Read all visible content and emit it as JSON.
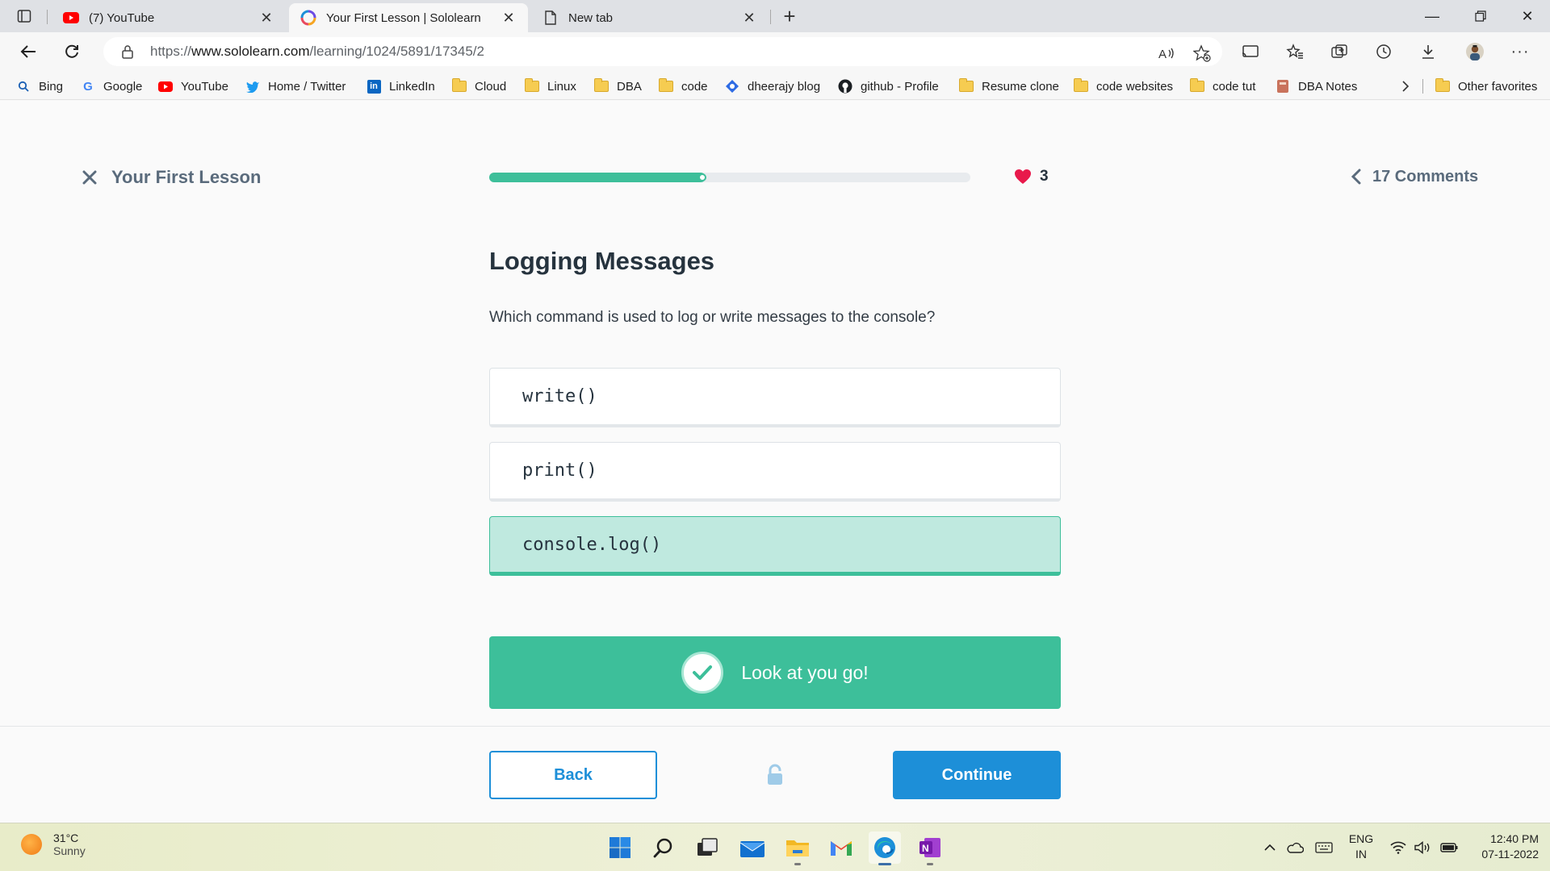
{
  "browser": {
    "tabs": [
      {
        "title": "(7) YouTube",
        "favicon": "youtube-icon",
        "active": false
      },
      {
        "title": "Your First Lesson | Sololearn",
        "favicon": "sololearn-icon",
        "active": true
      },
      {
        "title": "New tab",
        "favicon": "page-icon",
        "active": false
      }
    ],
    "url_prefix": "https://",
    "url_host": "www.sololearn.com",
    "url_path": "/learning/1024/5891/17345/2",
    "favorites": [
      {
        "label": "Bing",
        "icon": "search-icon"
      },
      {
        "label": "Google",
        "icon": "google-icon"
      },
      {
        "label": "YouTube",
        "icon": "youtube-icon"
      },
      {
        "label": "Home / Twitter",
        "icon": "twitter-icon"
      },
      {
        "label": "LinkedIn",
        "icon": "linkedin-icon"
      },
      {
        "label": "Cloud",
        "icon": "folder-icon"
      },
      {
        "label": "Linux",
        "icon": "folder-icon"
      },
      {
        "label": "DBA",
        "icon": "folder-icon"
      },
      {
        "label": "code",
        "icon": "folder-icon"
      },
      {
        "label": "dheerajy blog",
        "icon": "blog-icon"
      },
      {
        "label": "github - Profile",
        "icon": "github-icon"
      },
      {
        "label": "Resume clone",
        "icon": "folder-icon"
      },
      {
        "label": "code websites",
        "icon": "folder-icon"
      },
      {
        "label": "code tut",
        "icon": "folder-icon"
      },
      {
        "label": "DBA Notes",
        "icon": "notebook-icon"
      }
    ],
    "other_favorites": "Other favorites"
  },
  "lesson": {
    "title": "Your First Lesson",
    "progress": 0.45,
    "hearts": "3",
    "comments": "17 Comments",
    "question_title": "Logging Messages",
    "question_text": "Which command is used to log or write messages to the console?",
    "options": [
      {
        "text": "write()",
        "selected": false
      },
      {
        "text": "print()",
        "selected": false
      },
      {
        "text": "console.log()",
        "selected": true
      }
    ],
    "feedback": "Look at you go!",
    "back_label": "Back",
    "continue_label": "Continue"
  },
  "taskbar": {
    "temperature": "31°C",
    "condition": "Sunny",
    "language": "ENG",
    "region": "IN",
    "time": "12:40 PM",
    "date": "07-11-2022"
  },
  "colors": {
    "accent_green": "#3dbf9a",
    "accent_blue": "#1d8fd8",
    "heart_red": "#e8194b"
  }
}
